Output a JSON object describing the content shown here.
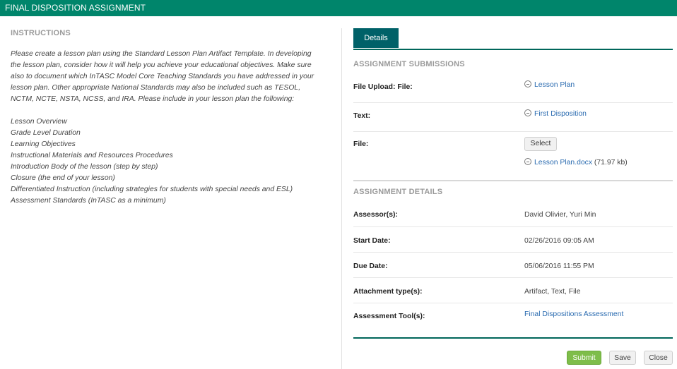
{
  "window": {
    "title": "FINAL DISPOSITION ASSIGNMENT"
  },
  "instructions": {
    "heading": "INSTRUCTIONS",
    "paragraph_lines": [
      "Please create a lesson plan using the Standard Lesson Plan Artifact Template. In developing",
      "the lesson plan, consider how it will help you achieve your educational objectives. Make sure",
      "also to document which InTASC Model Core Teaching Standards you have addressed in your",
      "lesson plan. Other appropriate National Standards may also be included such as TESOL,",
      "NCTM, NCTE, NSTA, NCSS, and IRA. Please include in your lesson plan the following:"
    ],
    "items": [
      "Lesson Overview",
      "Grade Level Duration",
      "Learning Objectives",
      "Instructional Materials and Resources Procedures",
      "Introduction Body of the lesson (step by step)",
      "Closure (the end of your lesson)",
      "Differentiated Instruction (including strategies for students with special needs and ESL)",
      "Assessment Standards (InTASC as a minimum)"
    ]
  },
  "tabs": [
    {
      "label": "Details",
      "active": true
    }
  ],
  "submissions": {
    "heading": "ASSIGNMENT SUBMISSIONS",
    "file_upload": {
      "label": "File Upload: File:",
      "value": "Lesson Plan"
    },
    "text": {
      "label": "Text:",
      "value": "First Disposition"
    },
    "file": {
      "label": "File:",
      "select_label": "Select",
      "attached_name": "Lesson Plan.docx",
      "attached_size": "(71.97 kb)"
    }
  },
  "details": {
    "heading": "ASSIGNMENT DETAILS",
    "assessors": {
      "label": "Assessor(s):",
      "value": "David Olivier, Yuri Min"
    },
    "start_date": {
      "label": "Start Date:",
      "value": "02/26/2016 09:05 AM"
    },
    "due_date": {
      "label": "Due Date:",
      "value": "05/06/2016 11:55 PM"
    },
    "attachment_types": {
      "label": "Attachment type(s):",
      "value": "Artifact, Text, File"
    },
    "assessment_tools": {
      "label": "Assessment Tool(s):",
      "value": "Final Dispositions Assessment"
    }
  },
  "actions": {
    "submit": "Submit",
    "save": "Save",
    "close": "Close"
  },
  "colors": {
    "titlebar": "#00856b",
    "tab": "#006168",
    "link": "#2a6bb0",
    "submit": "#7ebd4a"
  }
}
